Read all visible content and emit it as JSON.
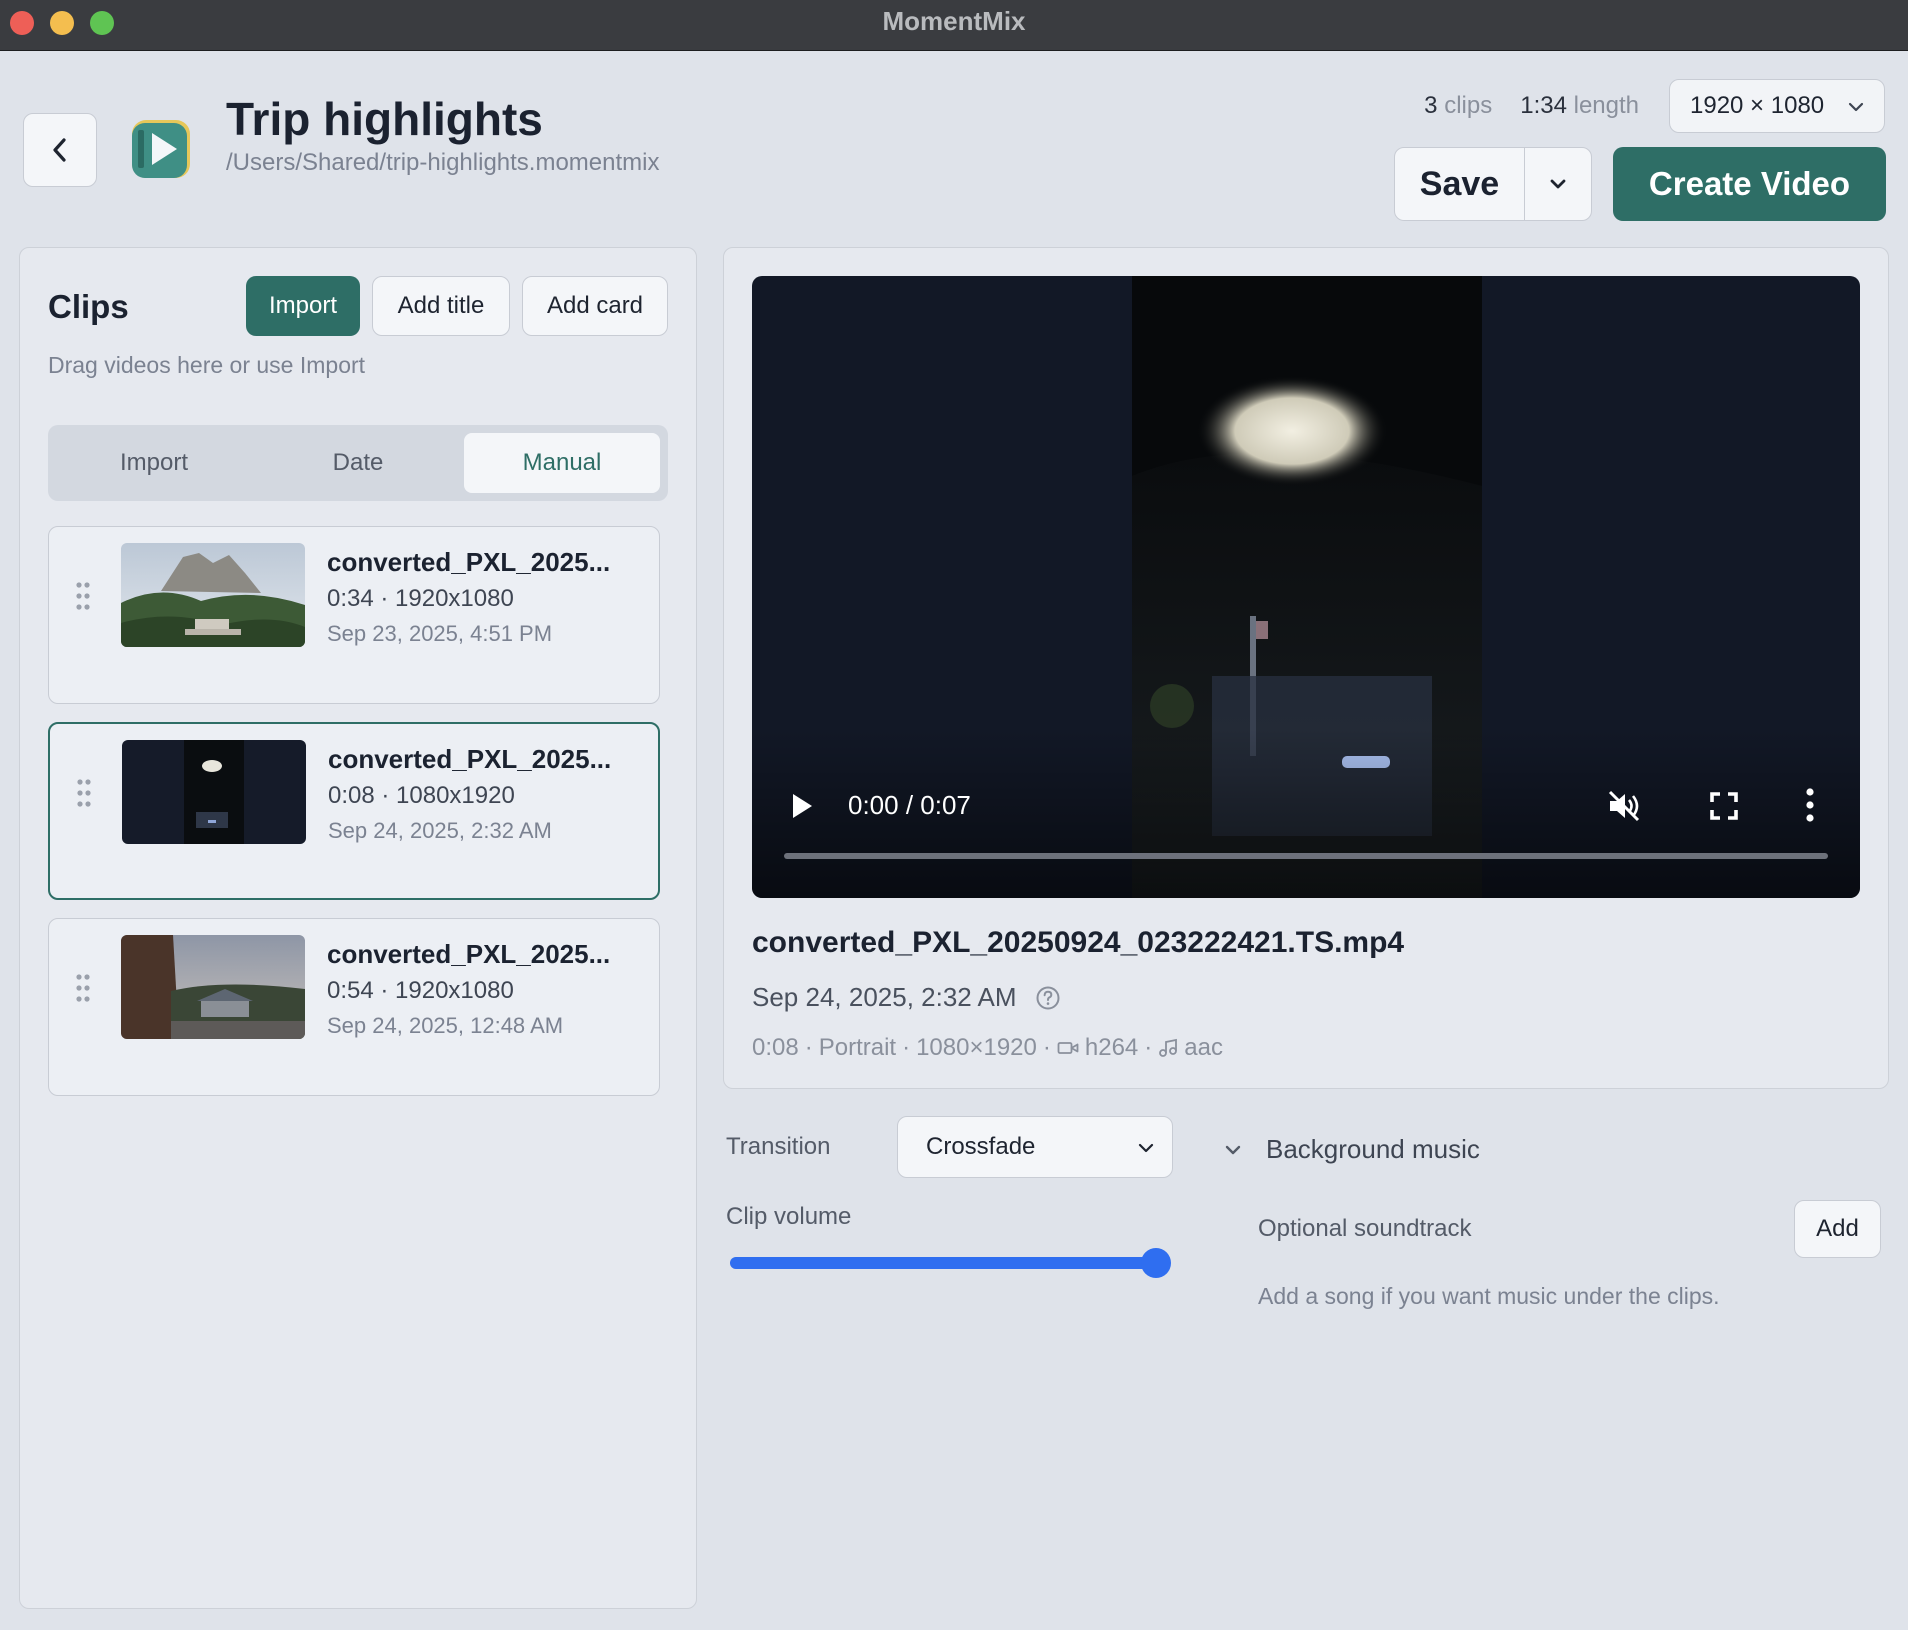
{
  "window": {
    "title": "MomentMix"
  },
  "header": {
    "project_title": "Trip highlights",
    "project_path": "/Users/Shared/trip-highlights.momentmix",
    "clip_count": "3",
    "clip_count_unit": "clips",
    "length": "1:34",
    "length_unit": "length",
    "resolution": "1920 × 1080",
    "save_label": "Save",
    "create_label": "Create Video"
  },
  "clips_panel": {
    "heading": "Clips",
    "import_label": "Import",
    "add_title_label": "Add title",
    "add_card_label": "Add card",
    "hint": "Drag videos here or use Import",
    "sort_tabs": [
      "Import",
      "Date",
      "Manual"
    ],
    "active_sort": "Manual",
    "clips": [
      {
        "name": "converted_PXL_2025...",
        "info": "0:34 · 1920x1080",
        "date": "Sep 23, 2025, 4:51 PM",
        "selected": false
      },
      {
        "name": "converted_PXL_2025...",
        "info": "0:08 · 1080x1920",
        "date": "Sep 24, 2025, 2:32 AM",
        "selected": true
      },
      {
        "name": "converted_PXL_2025...",
        "info": "0:54 · 1920x1080",
        "date": "Sep 24, 2025, 12:48 AM",
        "selected": false
      }
    ]
  },
  "preview": {
    "time": "0:00 / 0:07",
    "progress": 0,
    "file_name": "converted_PXL_20250924_023222421.TS.mp4",
    "date": "Sep 24, 2025, 2:32 AM",
    "duration": "0:08",
    "orientation": "Portrait",
    "dimensions": "1080×1920",
    "video_codec": "h264",
    "audio_codec": "aac"
  },
  "controls": {
    "transition_label": "Transition",
    "transition_value": "Crossfade",
    "music_label": "Background music",
    "volume_label": "Clip volume",
    "volume": 1.0,
    "soundtrack_label": "Optional soundtrack",
    "soundtrack_add": "Add",
    "soundtrack_hint": "Add a song if you want music under the clips."
  },
  "colors": {
    "accent": "#2e6e66",
    "slider": "#2f6ef0"
  }
}
